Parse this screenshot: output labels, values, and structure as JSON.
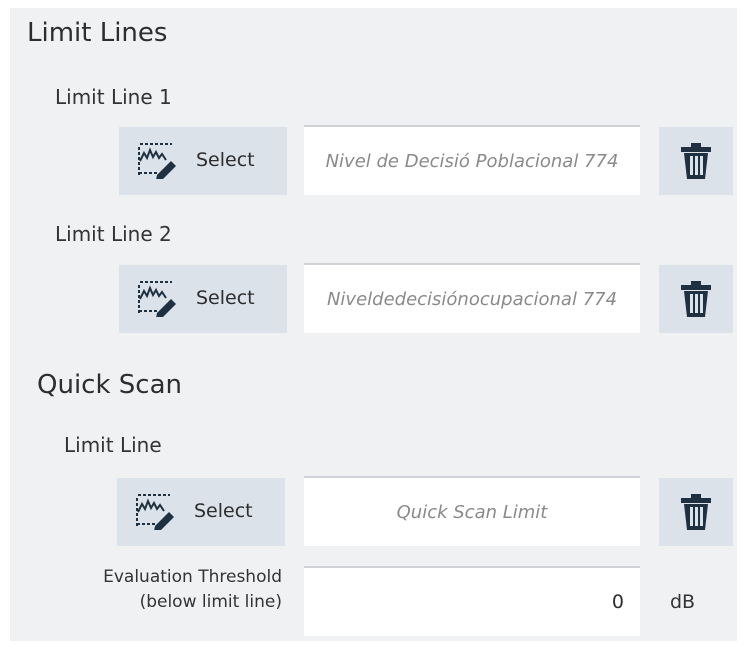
{
  "limit_lines": {
    "title": "Limit Lines",
    "line1": {
      "label": "Limit Line 1",
      "select_label": "Select",
      "value": "Nivel de Decisió Poblacional 774"
    },
    "line2": {
      "label": "Limit Line 2",
      "select_label": "Select",
      "value": "Niveldedecisiónocupacional 774"
    }
  },
  "quick_scan": {
    "title": "Quick Scan",
    "limit_line": {
      "label": "Limit Line",
      "select_label": "Select",
      "value": "Quick Scan Limit"
    },
    "threshold": {
      "label_line1": "Evaluation Threshold",
      "label_line2": "(below limit line)",
      "value": "0",
      "unit": "dB"
    }
  },
  "icons": {
    "select": "limit-line-edit-icon",
    "delete": "trash-icon"
  },
  "colors": {
    "panel_bg": "#f0f1f2",
    "button_bg": "#dbe2e9",
    "icon_dark": "#1f3140"
  }
}
